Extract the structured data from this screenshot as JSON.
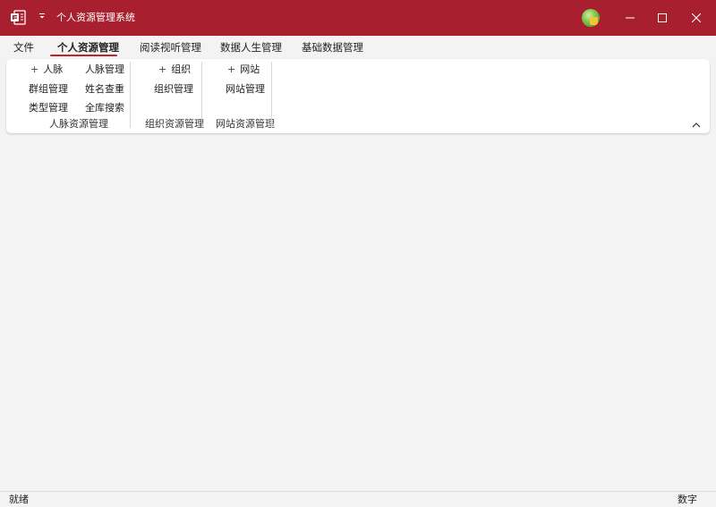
{
  "window": {
    "title": "个人资源管理系统",
    "app_icon": "office-app-icon",
    "accent_color": "#a8202f",
    "controls": [
      "minimize-icon",
      "maximize-icon",
      "close-icon"
    ]
  },
  "tabs": [
    {
      "label": "文件",
      "active": false
    },
    {
      "label": "个人资源管理",
      "active": true
    },
    {
      "label": "阅读视听管理",
      "active": false
    },
    {
      "label": "数据人生管理",
      "active": false
    },
    {
      "label": "基础数据管理",
      "active": false
    }
  ],
  "ribbon": {
    "groups": [
      {
        "label": "人脉资源管理",
        "buttons": [
          "人脉",
          "人脉管理",
          "群组管理",
          "姓名查重",
          "类型管理",
          "全库搜索"
        ]
      },
      {
        "label": "组织资源管理",
        "buttons": [
          "组织",
          "组织管理"
        ]
      },
      {
        "label": "网站资源管理",
        "buttons": [
          "网站",
          "网站管理"
        ]
      }
    ]
  },
  "status": {
    "left": "就绪",
    "right": "数字"
  }
}
